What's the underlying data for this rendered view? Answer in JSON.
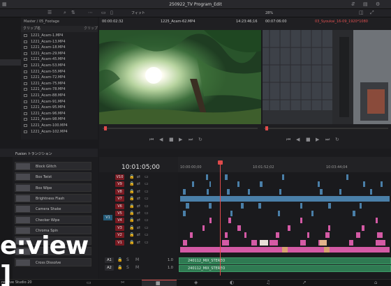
{
  "app": {
    "title": "250922_TV Program_Edit",
    "product": "resolve Studio 20",
    "watermark": "e:view ]"
  },
  "toolbar": {
    "fit_label": "フィット",
    "zoom_pct": "28%"
  },
  "source_viewer": {
    "timecode_left": "00:00:02:32",
    "clip_name": "1225_Acam-62.MP4",
    "timecode_right": "14:23:46;16"
  },
  "record_viewer": {
    "timecode_left": "00:07:06:00",
    "sequence_name": "03_Syoukai_16-09_1920*1080"
  },
  "media_pool": {
    "bin_label": "クリップ名",
    "path": "Master / 05_Footage",
    "right_header": "クリップ",
    "clips": [
      "1221_Acam-1.MP4",
      "1221_Acam-13.MP4",
      "1221_Acam-18.MP4",
      "1221_Acam-29.MP4",
      "1221_Acam-45.MP4",
      "1221_Acam-53.MP4",
      "1221_Acam-55.MP4",
      "1221_Acam-72.MP4",
      "1221_Acam-75.MP4",
      "1221_Acam-78.MP4",
      "1221_Acam-88.MP4",
      "1221_Acam-91.MP4",
      "1221_Acam-95.MP4",
      "1221_Acam-96.MP4",
      "1221_Acam-98.MP4",
      "1221_Acam-100.MP4",
      "1221_Acam-102.MP4"
    ]
  },
  "effects": {
    "header": "Fusion トランジション",
    "items": [
      "Block Glitch",
      "Box Twist",
      "Box Wipe",
      "Brightness Flash",
      "Camera Shake",
      "Checker Wipe",
      "Chroma Spin",
      "",
      "",
      "Cross Dissolve"
    ]
  },
  "timeline": {
    "timecode": "10:01:05;00",
    "ruler": [
      "10:00:00;00",
      "10:01:52;02",
      "10:03:44;04"
    ],
    "video_tracks": [
      "V10",
      "V9",
      "V8",
      "V7",
      "V6",
      "V5",
      "V4",
      "V3",
      "V2",
      "V1"
    ],
    "audio_tracks": [
      {
        "name": "A1",
        "level": "1.0",
        "clip": "240112_MIX_STEREO"
      },
      {
        "name": "A2",
        "level": "1.0",
        "clip": "240112_MIX_STEREO"
      }
    ],
    "src_patch": "V1",
    "audio_patch": "A1"
  },
  "colors": {
    "accent": "#e04b4b",
    "video_clip": "#4a7fa8",
    "pink_clip": "#d45aa5",
    "audio_clip": "#3b8a5e",
    "track_red": "#8c1f28"
  }
}
